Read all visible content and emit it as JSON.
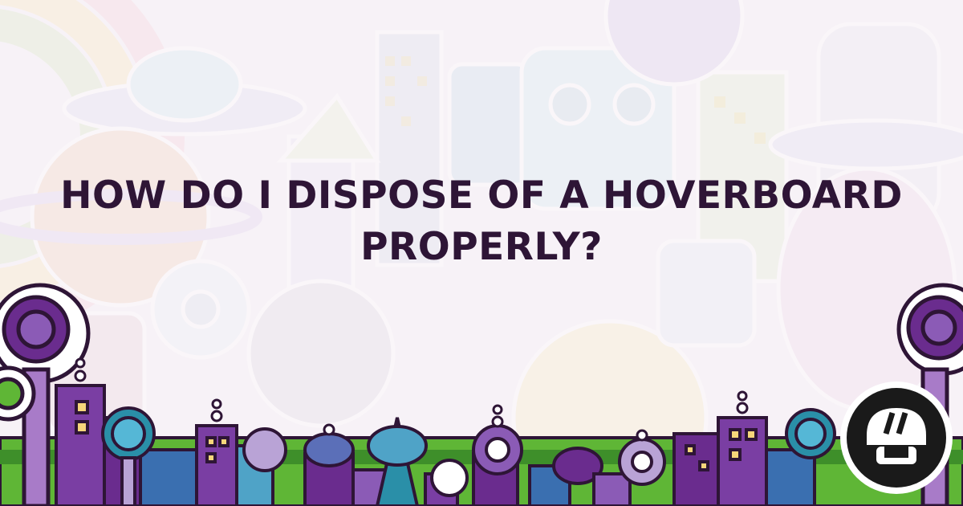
{
  "headline": {
    "line1": "HOW DO I DISPOSE OF A HOVERBOARD",
    "line2": "PROPERLY?"
  },
  "colors": {
    "title": "#2e1536",
    "purple": "#6a2c8e",
    "green": "#5fb636",
    "teal": "#2a8fa8",
    "lavender": "#b9a3d6"
  },
  "logo": {
    "icon": "helmet-logo-icon"
  }
}
